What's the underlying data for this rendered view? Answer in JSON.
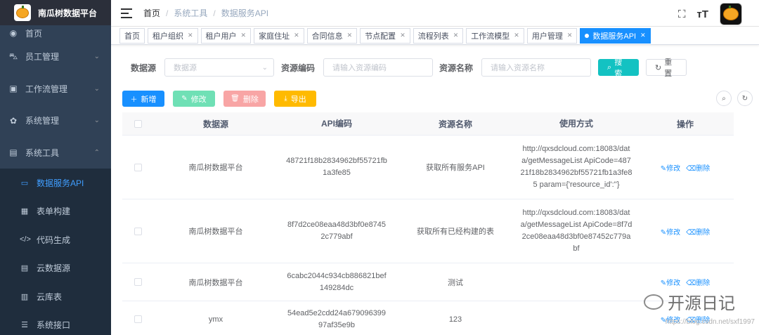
{
  "brand": {
    "title": "南瓜树数据平台"
  },
  "sidebar": {
    "items": [
      {
        "label": "首页",
        "icon": "dashboard-icon"
      },
      {
        "label": "员工管理",
        "icon": "staff-icon"
      },
      {
        "label": "工作流管理",
        "icon": "workflow-icon"
      },
      {
        "label": "系统管理",
        "icon": "gear-icon"
      },
      {
        "label": "系统工具",
        "icon": "toolbox-icon"
      }
    ],
    "submenu": [
      {
        "label": "数据服务API",
        "icon": "monitor-icon"
      },
      {
        "label": "表单构建",
        "icon": "form-icon"
      },
      {
        "label": "代码生成",
        "icon": "code-icon"
      },
      {
        "label": "云数据源",
        "icon": "database-icon"
      },
      {
        "label": "云库表",
        "icon": "table-icon"
      },
      {
        "label": "系统接口",
        "icon": "sliders-icon"
      }
    ]
  },
  "breadcrumb": {
    "home": "首页",
    "mid": "系统工具",
    "current": "数据服务API"
  },
  "tags": [
    {
      "label": "首页"
    },
    {
      "label": "租户组织"
    },
    {
      "label": "租户用户"
    },
    {
      "label": "家庭住址"
    },
    {
      "label": "合同信息"
    },
    {
      "label": "节点配置"
    },
    {
      "label": "流程列表"
    },
    {
      "label": "工作流模型"
    },
    {
      "label": "用户管理"
    },
    {
      "label": "数据服务API"
    }
  ],
  "search": {
    "source_label": "数据源",
    "source_placeholder": "数据源",
    "code_label": "资源编码",
    "code_placeholder": "请输入资源编码",
    "name_label": "资源名称",
    "name_placeholder": "请输入资源名称",
    "search_btn": "搜索",
    "reset_btn": "重置"
  },
  "toolbar": {
    "add": "新增",
    "edit": "修改",
    "delete": "删除",
    "export": "导出"
  },
  "table": {
    "headers": [
      "数据源",
      "API编码",
      "资源名称",
      "使用方式",
      "操作"
    ],
    "rows": [
      {
        "source": "南瓜树数据平台",
        "code": "48721f18b2834962bf55721fb1a3fe85",
        "name": "获取所有服务API",
        "usage": "http://qxsdcloud.com:18083/data/getMessageList ApiCode=48721f18b2834962bf55721fb1a3fe85 param={'resource_id':''}"
      },
      {
        "source": "南瓜树数据平台",
        "code": "8f7d2ce08eaa48d3bf0e87452c779abf",
        "name": "获取所有已经构建的表",
        "usage": "http://qxsdcloud.com:18083/data/getMessageList ApiCode=8f7d2ce08eaa48d3bf0e87452c779abf"
      },
      {
        "source": "南瓜树数据平台",
        "code": "6cabc2044c934cb886821bef149284dc",
        "name": "测试",
        "usage": ""
      },
      {
        "source": "ymx",
        "code": "54ead5e2cdd24a67909639997af35e9b",
        "name": "123",
        "usage": ""
      }
    ],
    "op_edit": "修改",
    "op_delete": "删除"
  },
  "watermark": {
    "text": "开源日记",
    "url": "https://blog.csdn.net/sxf1997"
  },
  "colors": {
    "sidebar_bg": "#304156",
    "primary": "#1890ff",
    "active_menu": "#409eff"
  }
}
